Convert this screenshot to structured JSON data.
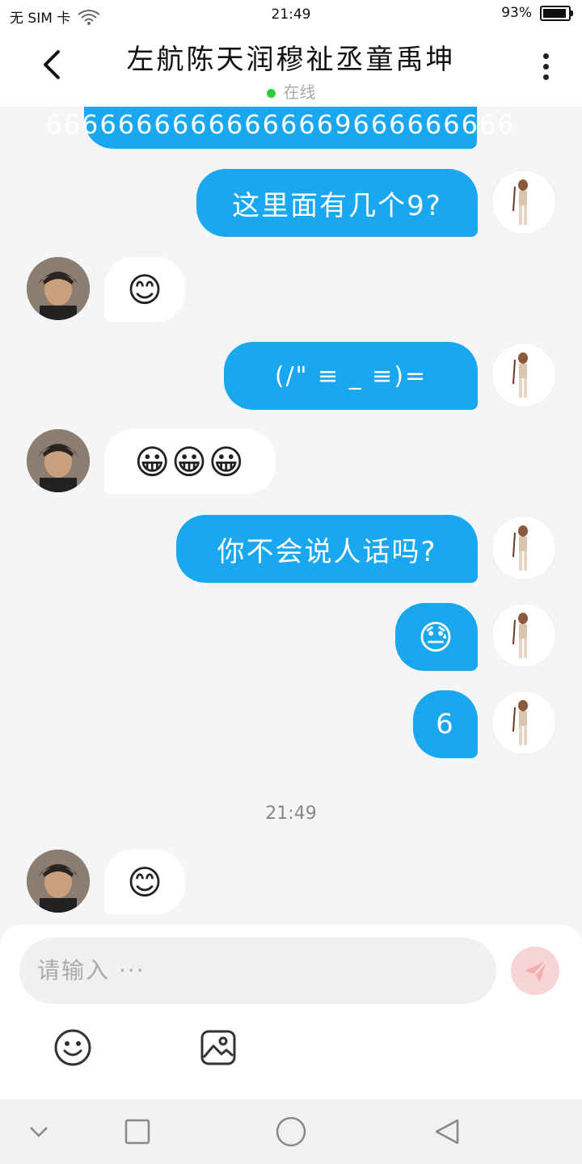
{
  "status": {
    "carrier": "无 SIM 卡",
    "time": "21:49",
    "battery": "93%",
    "battery_level": 0.93
  },
  "header": {
    "back_icon": "chevron-left-icon",
    "title": "左航陈天润穆祉丞童禹坤",
    "status": "在线",
    "more_icon": "more-vertical-icon"
  },
  "messages": [
    {
      "side": "out",
      "text": "66666666666666669666666666"
    },
    {
      "side": "out",
      "text": "这里面有几个9?"
    },
    {
      "side": "in",
      "text": "😊"
    },
    {
      "side": "out",
      "text": "(/\" ≡ _ ≡)="
    },
    {
      "side": "in",
      "text": "😀😀😀"
    },
    {
      "side": "out",
      "text": "你不会说人话吗?"
    },
    {
      "side": "out",
      "text": "😓"
    },
    {
      "side": "out",
      "text": "6"
    },
    {
      "side": "time",
      "text": "21:49"
    },
    {
      "side": "in",
      "text": "😊"
    }
  ],
  "input": {
    "placeholder": "请输入 ···",
    "send_icon": "send-icon",
    "emoji_icon": "emoji-icon",
    "image_icon": "image-icon"
  },
  "navbar": {
    "icons": [
      "chevron-down-icon",
      "square-icon",
      "circle-icon",
      "triangle-back-icon"
    ]
  },
  "colors": {
    "bubble_out": "#19a7f0",
    "bubble_in": "#ffffff",
    "background": "#f4f5f7",
    "online_dot": "#2ecc40",
    "send_button": "#f8d5d5"
  }
}
